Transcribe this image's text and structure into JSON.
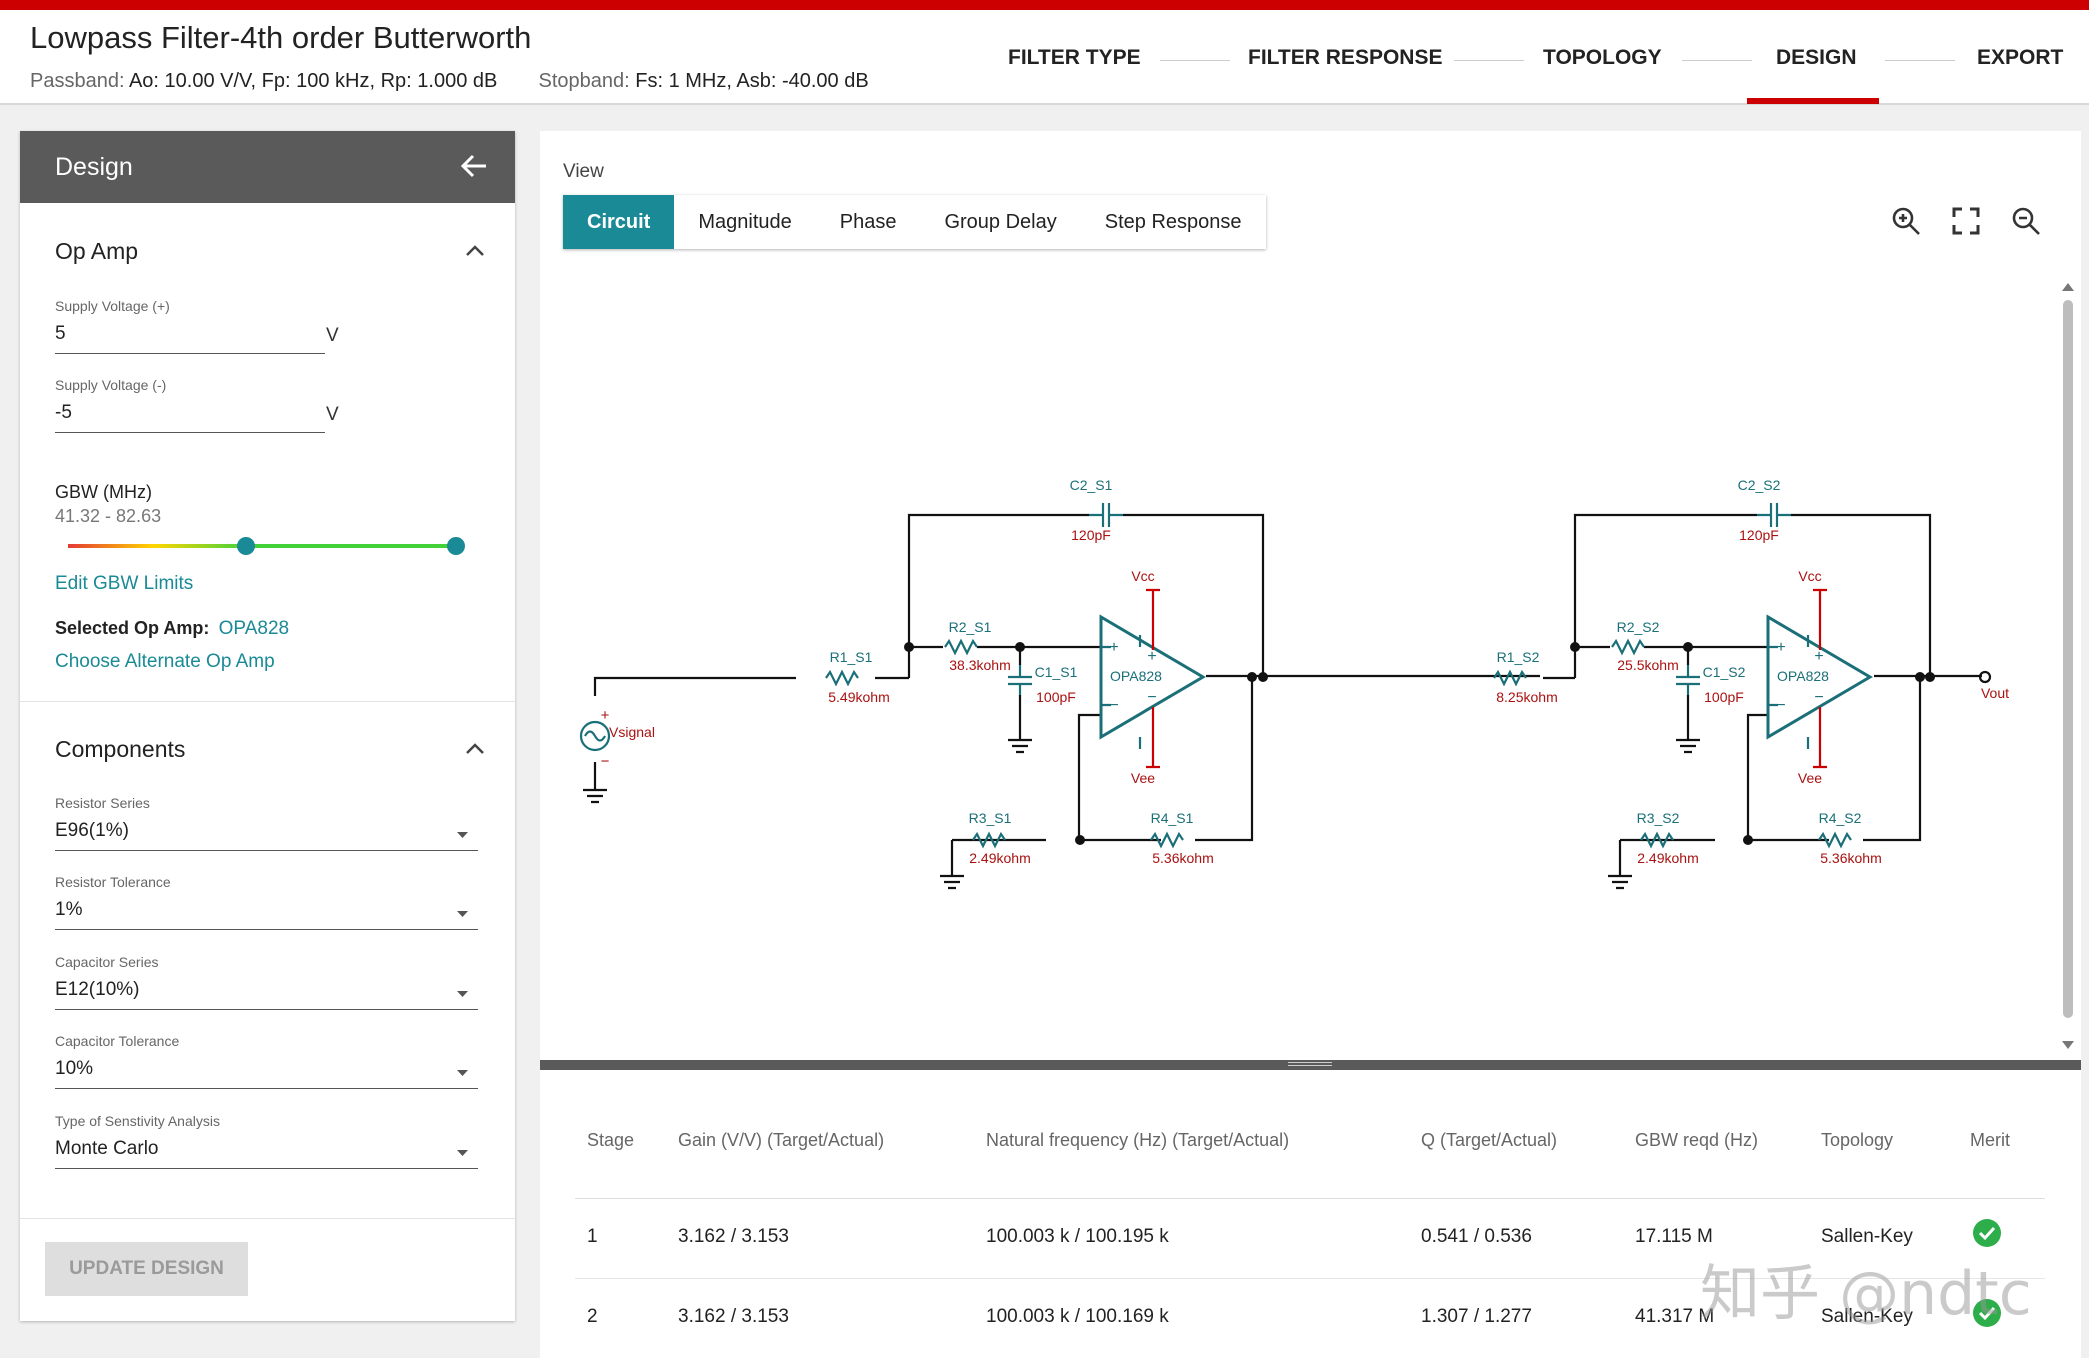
{
  "header": {
    "title": "Lowpass Filter-4th order Butterworth",
    "passband_key": "Passband:",
    "passband_val": "Ao: 10.00 V/V, Fp: 100 kHz, Rp: 1.000 dB",
    "stopband_key": "Stopband:",
    "stopband_val": "Fs: 1 MHz, Asb: -40.00 dB",
    "nav": [
      "FILTER TYPE",
      "FILTER RESPONSE",
      "TOPOLOGY",
      "DESIGN",
      "EXPORT"
    ],
    "active_nav": "DESIGN",
    "accent": "#cc0000"
  },
  "sidebar": {
    "title": "Design",
    "opamp": {
      "heading": "Op Amp",
      "vplus_label": "Supply Voltage (+)",
      "vplus_value": "5",
      "vminus_label": "Supply Voltage (-)",
      "vminus_value": "-5",
      "unit": "V",
      "gbw_label": "GBW (MHz)",
      "gbw_range": "41.32 - 82.63",
      "edit_link": "Edit GBW Limits",
      "selected_label": "Selected Op Amp:",
      "selected_value": "OPA828",
      "alt_link": "Choose Alternate Op Amp"
    },
    "components": {
      "heading": "Components",
      "fields": [
        {
          "label": "Resistor Series",
          "value": "E96(1%)"
        },
        {
          "label": "Resistor Tolerance",
          "value": "1%"
        },
        {
          "label": "Capacitor Series",
          "value": "E12(10%)"
        },
        {
          "label": "Capacitor Tolerance",
          "value": "10%"
        },
        {
          "label": "Type of Senstivity Analysis",
          "value": "Monte Carlo"
        }
      ]
    },
    "update_button": "UPDATE DESIGN"
  },
  "view": {
    "label": "View",
    "tabs": [
      "Circuit",
      "Magnitude",
      "Phase",
      "Group Delay",
      "Step Response"
    ],
    "active_tab": "Circuit",
    "tools": [
      "zoom-in-icon",
      "fit-screen-icon",
      "zoom-out-icon"
    ],
    "teal": "#1a8a96"
  },
  "circuit": {
    "source": "Vsignal",
    "output": "Vout",
    "supply_pos": "Vcc",
    "supply_neg": "Vee",
    "stages": [
      {
        "opamp": "OPA828",
        "r1": "R1_S1",
        "r1_val": "5.49kohm",
        "r2": "R2_S1",
        "r2_val": "38.3kohm",
        "c1": "C1_S1",
        "c1_val": "100pF",
        "c2": "C2_S1",
        "c2_val": "120pF",
        "r3": "R3_S1",
        "r3_val": "2.49kohm",
        "r4": "R4_S1",
        "r4_val": "5.36kohm"
      },
      {
        "opamp": "OPA828",
        "r1": "R1_S2",
        "r1_val": "8.25kohm",
        "r2": "R2_S2",
        "r2_val": "25.5kohm",
        "c1": "C1_S2",
        "c1_val": "100pF",
        "c2": "C2_S2",
        "c2_val": "120pF",
        "r3": "R3_S2",
        "r3_val": "2.49kohm",
        "r4": "R4_S2",
        "r4_val": "5.36kohm"
      }
    ]
  },
  "table": {
    "headers": [
      "Stage",
      "Gain (V/V) (Target/Actual)",
      "Natural frequency (Hz) (Target/Actual)",
      "Q (Target/Actual)",
      "GBW reqd (Hz)",
      "Topology",
      "Merit"
    ],
    "rows": [
      [
        "1",
        "3.162 / 3.153",
        "100.003 k / 100.195 k",
        "0.541 / 0.536",
        "17.115 M",
        "Sallen-Key"
      ],
      [
        "2",
        "3.162 / 3.153",
        "100.003 k / 100.169 k",
        "1.307 / 1.277",
        "41.317 M",
        "Sallen-Key"
      ]
    ]
  },
  "watermark": "知乎 @ndtc"
}
